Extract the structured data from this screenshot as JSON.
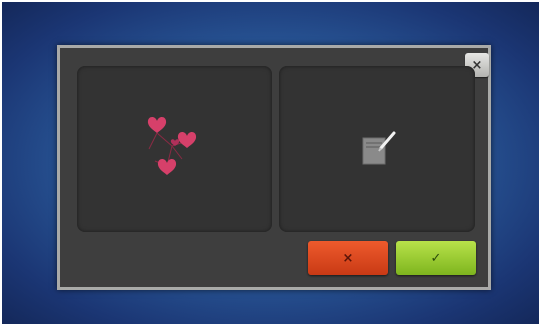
{
  "dialog": {
    "close_glyph": "×",
    "panels": [
      {
        "content": "embroidery-design",
        "icon": "hearts-design-icon"
      },
      {
        "content": "edit-design",
        "icon": "edit-pencil-icon"
      }
    ],
    "cancel_glyph": "×",
    "confirm_glyph": "✓"
  },
  "colors": {
    "background": "#2a5a9a",
    "dialog_bg": "#3e3e3e",
    "panel_bg": "#333333",
    "heart": "#d6406a",
    "cancel": "#e04a20",
    "confirm": "#9ccc35"
  }
}
